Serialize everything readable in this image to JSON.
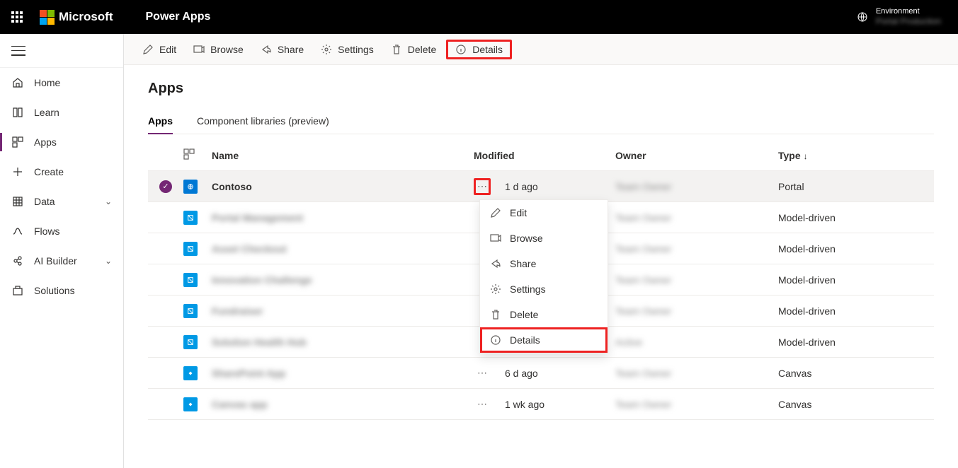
{
  "topbar": {
    "brand": "Microsoft",
    "product": "Power Apps",
    "env_label": "Environment",
    "env_value": "Portal Production"
  },
  "sidebar": {
    "items": [
      {
        "label": "Home",
        "icon": "home"
      },
      {
        "label": "Learn",
        "icon": "book"
      },
      {
        "label": "Apps",
        "icon": "apps",
        "active": true
      },
      {
        "label": "Create",
        "icon": "plus"
      },
      {
        "label": "Data",
        "icon": "data",
        "expandable": true
      },
      {
        "label": "Flows",
        "icon": "flow"
      },
      {
        "label": "AI Builder",
        "icon": "ai",
        "expandable": true
      },
      {
        "label": "Solutions",
        "icon": "solutions"
      }
    ]
  },
  "cmdbar": {
    "edit": "Edit",
    "browse": "Browse",
    "share": "Share",
    "settings": "Settings",
    "delete": "Delete",
    "details": "Details"
  },
  "page": {
    "title": "Apps",
    "tabs": {
      "apps": "Apps",
      "libs": "Component libraries (preview)"
    }
  },
  "table": {
    "headers": {
      "name": "Name",
      "modified": "Modified",
      "owner": "Owner",
      "type": "Type"
    },
    "sort_indicator": "↓",
    "rows": [
      {
        "name": "Contoso",
        "modified": "1 d ago",
        "owner": "Team Owner",
        "type": "Portal",
        "selected": true,
        "icon": "portal",
        "show_more_highlight": true,
        "blur_name": false
      },
      {
        "name": "Portal Management",
        "modified": "",
        "owner": "Team Owner",
        "type": "Model-driven",
        "icon": "model",
        "blur_name": true
      },
      {
        "name": "Asset Checkout",
        "modified": "",
        "owner": "Team Owner",
        "type": "Model-driven",
        "icon": "model",
        "blur_name": true
      },
      {
        "name": "Innovation Challenge",
        "modified": "",
        "owner": "Team Owner",
        "type": "Model-driven",
        "icon": "model",
        "blur_name": true
      },
      {
        "name": "Fundraiser",
        "modified": "",
        "owner": "Team Owner",
        "type": "Model-driven",
        "icon": "model",
        "blur_name": true
      },
      {
        "name": "Solution Health Hub",
        "modified": "",
        "owner": "Active",
        "type": "Model-driven",
        "icon": "model",
        "blur_name": true
      },
      {
        "name": "SharePoint App",
        "modified": "6 d ago",
        "owner": "Team Owner",
        "type": "Canvas",
        "icon": "canvas",
        "blur_name": true,
        "show_more": true
      },
      {
        "name": "Canvas app",
        "modified": "1 wk ago",
        "owner": "Team Owner",
        "type": "Canvas",
        "icon": "canvas",
        "blur_name": true,
        "show_more": true
      }
    ]
  },
  "context_menu": {
    "edit": "Edit",
    "browse": "Browse",
    "share": "Share",
    "settings": "Settings",
    "delete": "Delete",
    "details": "Details"
  }
}
